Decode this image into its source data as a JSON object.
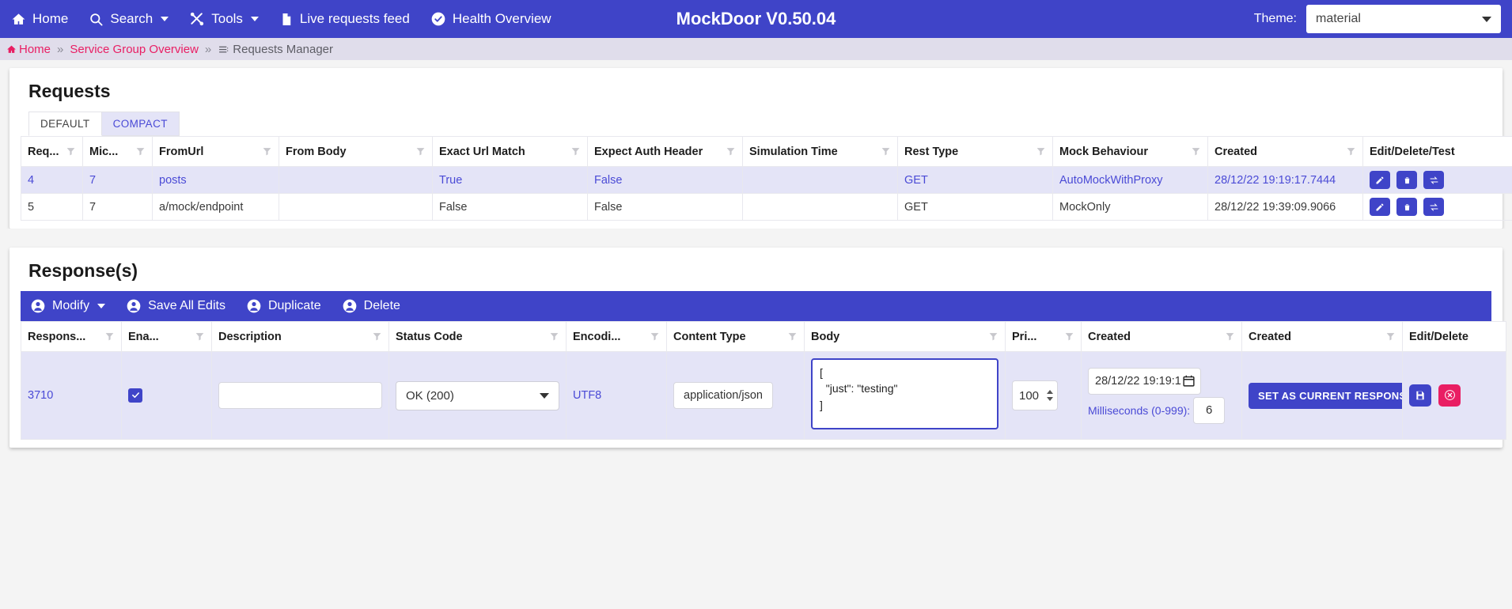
{
  "topnav": {
    "items": [
      {
        "label": "Home",
        "icon": "home-icon",
        "caret": false
      },
      {
        "label": "Search",
        "icon": "search-icon",
        "caret": true
      },
      {
        "label": "Tools",
        "icon": "tools-icon",
        "caret": true
      },
      {
        "label": "Live requests feed",
        "icon": "document-icon",
        "caret": false
      },
      {
        "label": "Health Overview",
        "icon": "check-circle-icon",
        "caret": false
      }
    ],
    "app_title": "MockDoor V0.50.04",
    "theme_label": "Theme:",
    "theme_value": "material",
    "theme_options": [
      "material"
    ]
  },
  "breadcrumb": {
    "home": "Home",
    "service_group": "Service Group Overview",
    "current": "Requests Manager",
    "separator": "»"
  },
  "requests": {
    "title": "Requests",
    "tabs": [
      {
        "label": "DEFAULT",
        "selected": true
      },
      {
        "label": "COMPACT",
        "selected": false
      }
    ],
    "columns": [
      "Req...",
      "Mic...",
      "FromUrl",
      "From Body",
      "Exact Url Match",
      "Expect Auth Header",
      "Simulation Time",
      "Rest Type",
      "Mock Behaviour",
      "Created",
      "Edit/Delete/Test"
    ],
    "rows": [
      {
        "selected": true,
        "req_id": "4",
        "mic": "7",
        "from_url": "posts",
        "from_body": "",
        "exact_url_match": "True",
        "expect_auth_header": "False",
        "simulation_time": "",
        "rest_type": "GET",
        "mock_behaviour": "AutoMockWithProxy",
        "created": "28/12/22 19:19:17.7444",
        "actions": [
          "edit-icon",
          "delete-icon",
          "test-icon"
        ]
      },
      {
        "selected": false,
        "req_id": "5",
        "mic": "7",
        "from_url": "a/mock/endpoint",
        "from_body": "",
        "exact_url_match": "False",
        "expect_auth_header": "False",
        "simulation_time": "",
        "rest_type": "GET",
        "mock_behaviour": "MockOnly",
        "created": "28/12/22 19:39:09.9066",
        "actions": [
          "edit-icon",
          "delete-icon",
          "test-icon"
        ]
      }
    ]
  },
  "responses": {
    "title": "Response(s)",
    "toolbar": [
      {
        "label": "Modify",
        "icon": "person-icon",
        "caret": true
      },
      {
        "label": "Save All Edits",
        "icon": "person-icon",
        "caret": false
      },
      {
        "label": "Duplicate",
        "icon": "person-icon",
        "caret": false
      },
      {
        "label": "Delete",
        "icon": "person-icon",
        "caret": false
      }
    ],
    "columns": [
      "Respons...",
      "Ena...",
      "Description",
      "Status Code",
      "Encodi...",
      "Content Type",
      "Body",
      "Pri...",
      "Created",
      "Created",
      "Edit/Delete"
    ],
    "row": {
      "selected": true,
      "response_id": "3710",
      "enabled": true,
      "description": "",
      "description_placeholder": "",
      "status_code": "OK (200)",
      "status_code_options": [
        "OK (200)"
      ],
      "encoding": "UTF8",
      "content_type": "application/json",
      "body": "[\n  \"just\": \"testing\"\n]",
      "priority": "100",
      "created_date": "28/12/22 19:19:1",
      "milliseconds_label": "Milliseconds (0-999):",
      "milliseconds_value": "6",
      "set_current_label": "SET AS CURRENT RESPONSE",
      "actions": [
        "save-icon",
        "delete-icon"
      ]
    }
  },
  "colors": {
    "primary": "#3f44c8",
    "accent_link": "#4a4ad6",
    "crumb_link": "#e91e63",
    "selected_row": "#e4e4f7",
    "delete_red": "#e91e63"
  }
}
